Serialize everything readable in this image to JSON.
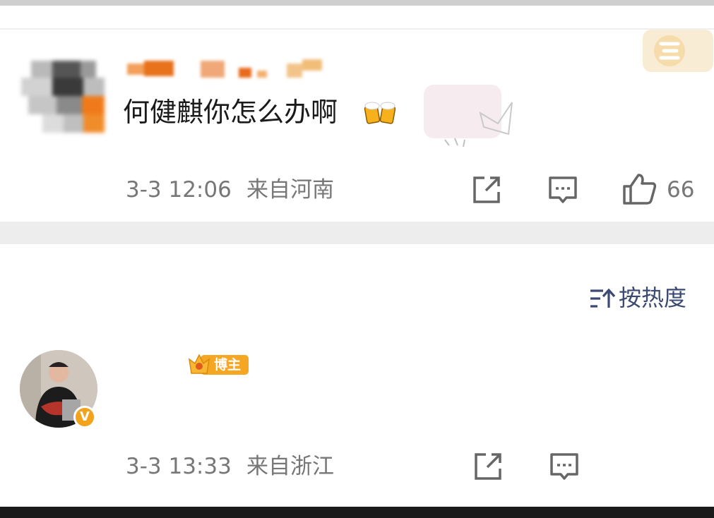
{
  "comment1": {
    "text": "何健麒你怎么办啊",
    "emoji_icon": "beer-cheers-icon",
    "time": "3-3 12:06",
    "location": "来自河南",
    "like_count": "66"
  },
  "sort": {
    "label": "按热度",
    "icon": "sort-icon"
  },
  "comment2": {
    "author_badge": "博主",
    "verified_mark": "V",
    "time": "3-3 13:33",
    "location": "来自浙江"
  },
  "colors": {
    "meta_text": "#777777",
    "sort_text": "#3b4a72",
    "badge_orange": "#f3a21b",
    "band_gray": "#ededed"
  }
}
